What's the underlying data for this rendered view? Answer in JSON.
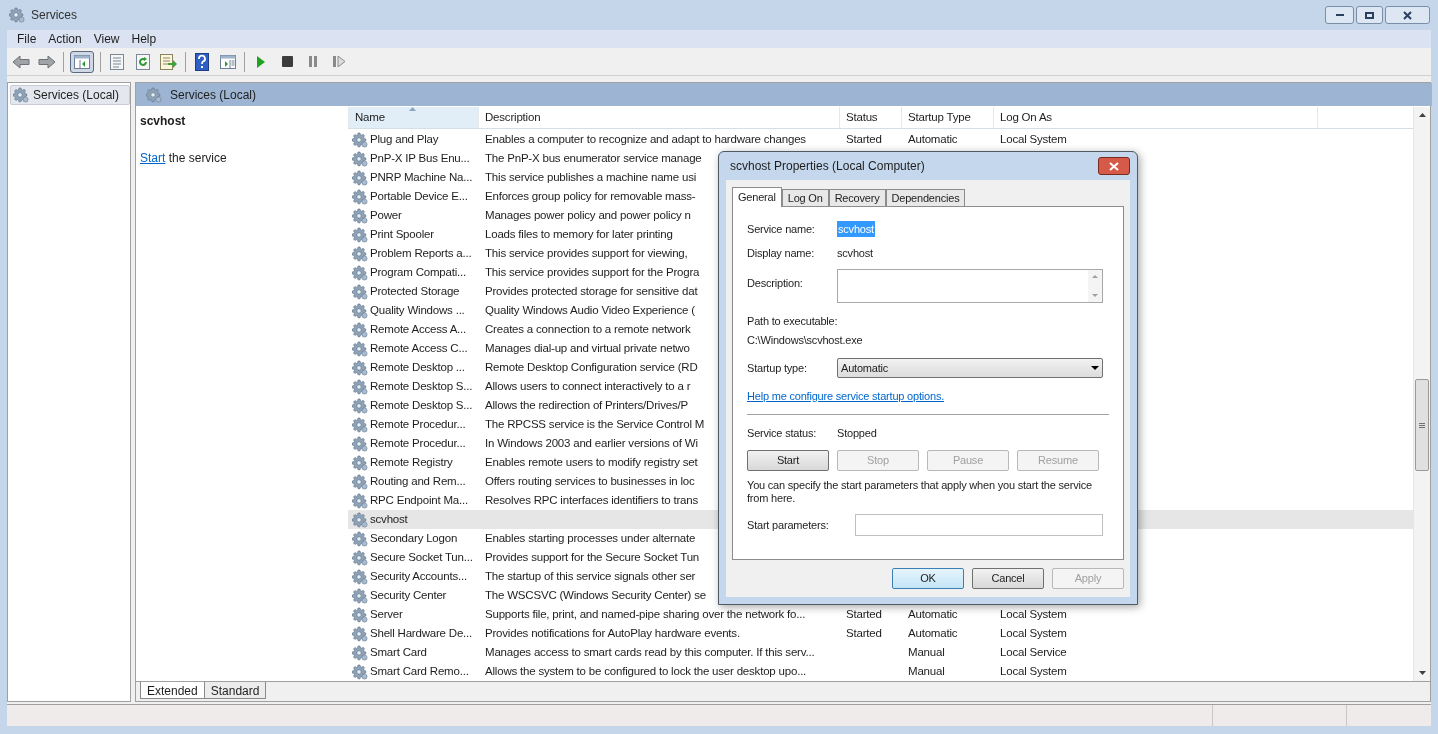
{
  "window": {
    "title": "Services"
  },
  "menu": [
    {
      "label": "File"
    },
    {
      "label": "Action"
    },
    {
      "label": "View"
    },
    {
      "label": "Help"
    }
  ],
  "toolbar": [
    {
      "kind": "back",
      "pressed": false
    },
    {
      "kind": "forward",
      "pressed": false
    },
    {
      "kind": "sep"
    },
    {
      "kind": "tree",
      "pressed": true
    },
    {
      "kind": "sep"
    },
    {
      "kind": "properties",
      "pressed": false
    },
    {
      "kind": "refresh",
      "pressed": false
    },
    {
      "kind": "export",
      "pressed": false
    },
    {
      "kind": "sep"
    },
    {
      "kind": "help",
      "pressed": false
    },
    {
      "kind": "pane",
      "pressed": false
    },
    {
      "kind": "sep"
    },
    {
      "kind": "play",
      "pressed": false
    },
    {
      "kind": "stop",
      "pressed": false
    },
    {
      "kind": "pause",
      "pressed": false
    },
    {
      "kind": "resume",
      "pressed": false
    }
  ],
  "tree": {
    "items": [
      {
        "label": "Services (Local)",
        "selected": true
      }
    ]
  },
  "pane_header": {
    "title": "Services (Local)"
  },
  "detail": {
    "title": "scvhost",
    "link": "Start",
    "text": "the service"
  },
  "table": {
    "columns": [
      "Name",
      "Description",
      "Status",
      "Startup Type",
      "Log On As"
    ],
    "rows": [
      {
        "name": "Plug and Play",
        "description": "Enables a computer to recognize and adapt to hardware changes",
        "status": "Started",
        "startup": "Automatic",
        "logon": "Local System",
        "selected": false
      },
      {
        "name": "PnP-X IP Bus Enu...",
        "description": "The PnP-X bus enumerator service manage",
        "selected": false
      },
      {
        "name": "PNRP Machine Na...",
        "description": "This service publishes a machine name usi",
        "selected": false
      },
      {
        "name": "Portable Device E...",
        "description": "Enforces group policy for removable mass-",
        "selected": false
      },
      {
        "name": "Power",
        "description": "Manages power policy and power policy n",
        "selected": false
      },
      {
        "name": "Print Spooler",
        "description": "Loads files to memory for later printing",
        "selected": false
      },
      {
        "name": "Problem Reports a...",
        "description": "This service provides support for viewing,",
        "selected": false
      },
      {
        "name": "Program Compati...",
        "description": "This service provides support for the Progra",
        "selected": false
      },
      {
        "name": "Protected Storage",
        "description": "Provides protected storage for sensitive dat",
        "selected": false
      },
      {
        "name": "Quality Windows ...",
        "description": "Quality Windows Audio Video Experience (",
        "selected": false
      },
      {
        "name": "Remote Access A...",
        "description": "Creates a connection to a remote network",
        "selected": false
      },
      {
        "name": "Remote Access C...",
        "description": "Manages dial-up and virtual private netwo",
        "selected": false
      },
      {
        "name": "Remote Desktop ...",
        "description": "Remote Desktop Configuration service (RD",
        "selected": false
      },
      {
        "name": "Remote Desktop S...",
        "description": "Allows users to connect interactively to a r",
        "selected": false
      },
      {
        "name": "Remote Desktop S...",
        "description": "Allows the redirection of Printers/Drives/P",
        "selected": false
      },
      {
        "name": "Remote Procedur...",
        "description": "The RPCSS service is the Service Control M",
        "selected": false
      },
      {
        "name": "Remote Procedur...",
        "description": "In Windows 2003 and earlier versions of Wi",
        "selected": false
      },
      {
        "name": "Remote Registry",
        "description": "Enables remote users to modify registry set",
        "selected": false
      },
      {
        "name": "Routing and Rem...",
        "description": "Offers routing services to businesses in loc",
        "selected": false
      },
      {
        "name": "RPC Endpoint Ma...",
        "description": "Resolves RPC interfaces identifiers to trans",
        "selected": false
      },
      {
        "name": "scvhost",
        "selected": true
      },
      {
        "name": "Secondary Logon",
        "description": "Enables starting processes under alternate",
        "selected": false
      },
      {
        "name": "Secure Socket Tun...",
        "description": "Provides support for the Secure Socket Tun",
        "selected": false
      },
      {
        "name": "Security Accounts...",
        "description": "The startup of this service signals other ser",
        "selected": false
      },
      {
        "name": "Security Center",
        "description": "The WSCSVC (Windows Security Center) se",
        "selected": false
      },
      {
        "name": "Server",
        "description": "Supports file, print, and named-pipe sharing over the network fo...",
        "status": "Started",
        "startup": "Automatic",
        "logon": "Local System",
        "selected": false
      },
      {
        "name": "Shell Hardware De...",
        "description": "Provides notifications for AutoPlay hardware events.",
        "status": "Started",
        "startup": "Automatic",
        "logon": "Local System",
        "selected": false
      },
      {
        "name": "Smart Card",
        "description": "Manages access to smart cards read by this computer. If this serv...",
        "startup": "Manual",
        "logon": "Local Service",
        "selected": false
      },
      {
        "name": "Smart Card Remo...",
        "description": "Allows the system to be configured to lock the user desktop upo...",
        "startup": "Manual",
        "logon": "Local System",
        "selected": false
      }
    ]
  },
  "view_tabs": [
    {
      "label": "Extended",
      "selected": true
    },
    {
      "label": "Standard",
      "selected": false
    }
  ],
  "dialog": {
    "title": "scvhost Properties (Local Computer)",
    "tabs": [
      {
        "label": "General",
        "selected": true
      },
      {
        "label": "Log On",
        "selected": false
      },
      {
        "label": "Recovery",
        "selected": false
      },
      {
        "label": "Dependencies",
        "selected": false
      }
    ],
    "service_name": {
      "label": "Service name:",
      "value": "scvhost",
      "highlighted": true
    },
    "display_name": {
      "label": "Display name:",
      "value": "scvhost"
    },
    "description": {
      "label": "Description:"
    },
    "path": {
      "label": "Path to executable:",
      "value": "C:\\Windows\\scvhost.exe"
    },
    "startup_type": {
      "label": "Startup type:",
      "value": "Automatic"
    },
    "help_link": "Help me configure service startup options.",
    "status": {
      "label": "Service status:",
      "value": "Stopped"
    },
    "service_buttons": [
      {
        "label": "Start",
        "disabled": false
      },
      {
        "label": "Stop",
        "disabled": true
      },
      {
        "label": "Pause",
        "disabled": true
      },
      {
        "label": "Resume",
        "disabled": true
      }
    ],
    "note": "You can specify the start parameters that apply when you start the service from here.",
    "start_parameters": {
      "label": "Start parameters:"
    },
    "buttons": [
      {
        "label": "OK",
        "disabled": false,
        "default": true
      },
      {
        "label": "Cancel",
        "disabled": false,
        "default": false
      },
      {
        "label": "Apply",
        "disabled": true,
        "default": false
      }
    ]
  }
}
